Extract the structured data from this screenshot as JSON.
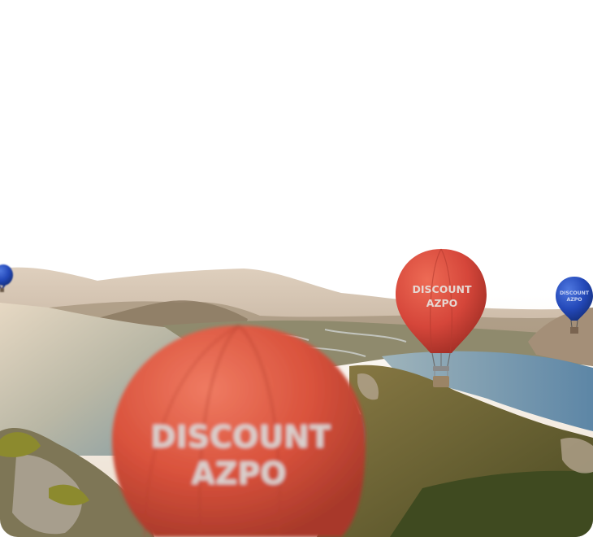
{
  "scene": {
    "balloons": [
      {
        "lines": [
          "DISCOUNT",
          "AZPO"
        ],
        "color": "#e0553f",
        "kind": "large-foreground"
      },
      {
        "lines": [
          "DISCOUNT",
          "AZPO"
        ],
        "color": "#d9473a",
        "kind": "medium"
      },
      {
        "lines": [
          "DISCOUNT",
          "AZPO"
        ],
        "color": "#1f47b8",
        "kind": "small"
      },
      {
        "lines": [],
        "color": "#1f47b8",
        "kind": "edge"
      }
    ],
    "colors": {
      "sky": "#ffffff",
      "water": "#6f93a6",
      "lagoon": "#5f7f6a",
      "forest": "#5c5a2c",
      "rock": "#9b8f7e",
      "haze": "#e8d7c2"
    }
  }
}
